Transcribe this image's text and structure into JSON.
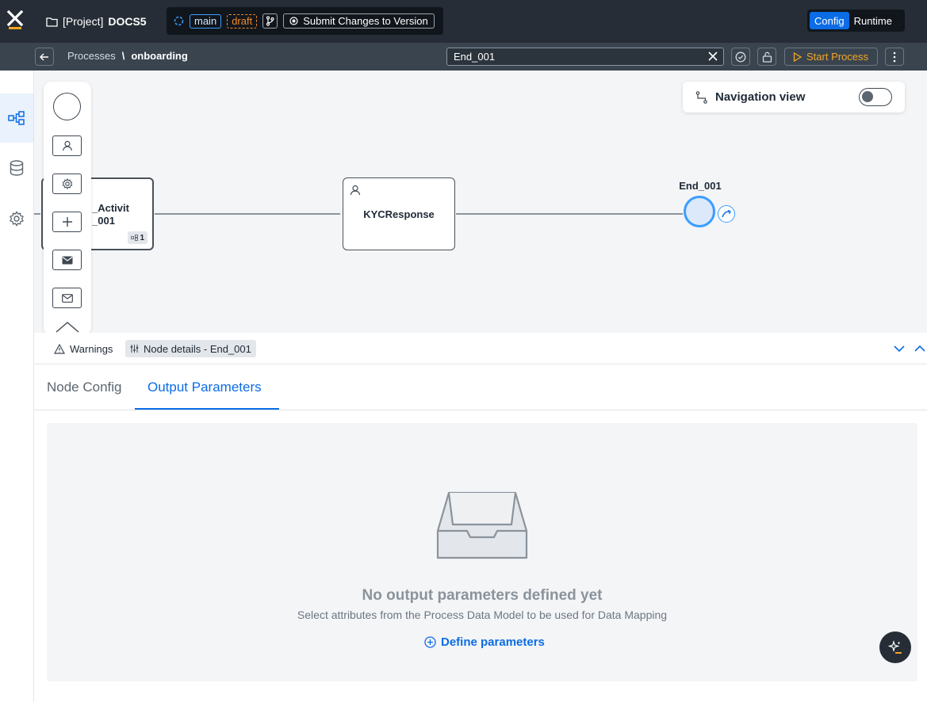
{
  "header": {
    "project_prefix": "[Project]",
    "project_name": "DOCS5",
    "branch": "main",
    "status": "draft",
    "submit_label": "Submit Changes to Version",
    "modes": [
      "Config",
      "Runtime"
    ],
    "active_mode": "Config"
  },
  "subheader": {
    "breadcrumb_root": "Processes",
    "breadcrumb_sep": "\\",
    "breadcrumb_current": "onboarding",
    "search_value": "End_001",
    "start_label": "Start Process"
  },
  "canvas": {
    "nav_view_label": "Navigation view",
    "nodes": {
      "activity_line1": "_Activit",
      "activity_line2": "_001",
      "activity_badge": "1",
      "kyc": "KYCResponse",
      "end": "End_001"
    }
  },
  "panel": {
    "warnings_label": "Warnings",
    "node_details_label": "Node details - End_001",
    "tabs": [
      "Node Config",
      "Output Parameters"
    ],
    "active_tab": "Output Parameters",
    "empty_title": "No output parameters defined yet",
    "empty_subtitle": "Select attributes from the Process Data Model to be used for Data Mapping",
    "define_label": "Define parameters"
  },
  "colors": {
    "accent": "#0b6ce6",
    "draft": "#f08a2b",
    "start": "#f5a623",
    "topbar": "#262d36"
  }
}
